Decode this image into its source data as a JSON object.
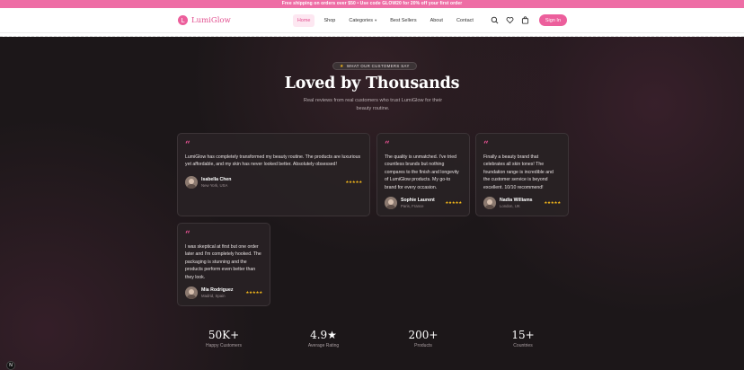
{
  "promo": {
    "text": "Free shipping on orders over $50 • Use code GLOW20 for 20% off your first order"
  },
  "nav": {
    "logo_text": "LumiGlow",
    "logo_letter": "L",
    "items": [
      {
        "label": "Home",
        "active": true
      },
      {
        "label": "Shop",
        "active": false
      },
      {
        "label": "Categories",
        "active": false,
        "has_dropdown": true
      },
      {
        "label": "Best Sellers",
        "active": false
      },
      {
        "label": "About",
        "active": false
      },
      {
        "label": "Contact",
        "active": false
      }
    ],
    "icons": [
      "search-icon",
      "heart-icon",
      "bag-icon"
    ],
    "signin_label": "Sign In"
  },
  "testimonials": {
    "badge_text": "WHAT OUR CUSTOMERS SAY",
    "badge_icon": "star-icon",
    "title": "Loved by Thousands",
    "subtitle": "Real reviews from real customers who trust LumiGlow for their beauty routine.",
    "quote_mark": "“",
    "stars": "★★★★★",
    "rating": 5,
    "reviews": [
      {
        "text": "LumiGlow has completely transformed my beauty routine. The products are luxurious yet affordable, and my skin has never looked better. Absolutely obsessed!",
        "name": "Isabella Chen",
        "location": "New York, USA"
      },
      {
        "text": "The quality is unmatched. I've tried countless brands but nothing compares to the finish and longevity of LumiGlow products. My go-to brand for every occasion.",
        "name": "Sophie Laurent",
        "location": "Paris, France"
      },
      {
        "text": "Finally a beauty brand that celebrates all skin tones! The foundation range is incredible and the customer service is beyond excellent. 10/10 recommend!",
        "name": "Nadia Williams",
        "location": "London, UK"
      },
      {
        "text": "I was skeptical at first but one order later and I'm completely hooked. The packaging is stunning and the products perform even better than they look.",
        "name": "Mia Rodriguez",
        "location": "Madrid, Spain"
      }
    ]
  },
  "stats": [
    {
      "value": "50K+",
      "label": "Happy Customers"
    },
    {
      "value": "4.9★",
      "label": "Average Rating"
    },
    {
      "value": "200+",
      "label": "Products"
    },
    {
      "value": "15+",
      "label": "Countries"
    }
  ],
  "colors": {
    "accent": "#ec5f9c",
    "promo": "#ee6da5",
    "background": "#1c1719",
    "star": "#f5b81a"
  },
  "dev_badge": "N"
}
